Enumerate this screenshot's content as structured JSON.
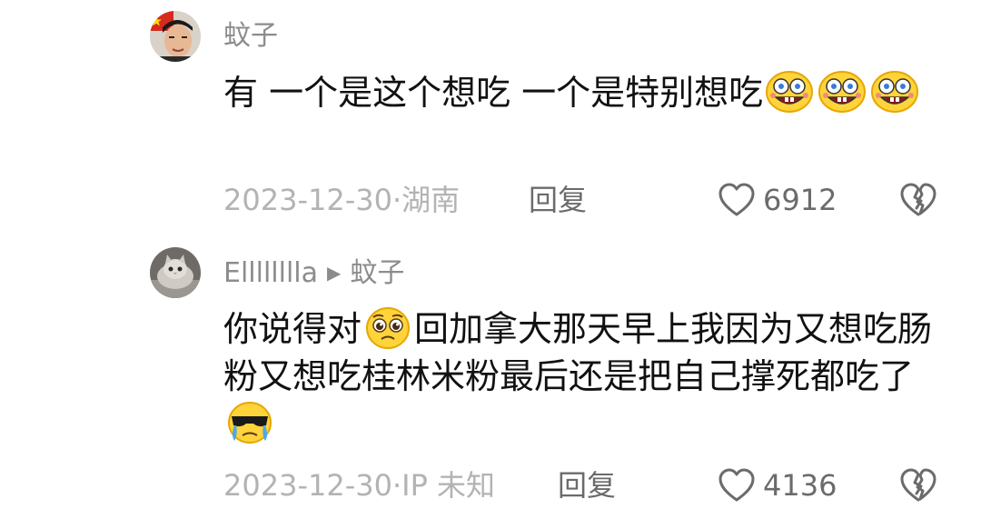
{
  "comments": [
    {
      "username": "蚊子",
      "avatar": "avatar-man-with-flag",
      "text": {
        "part1": "有  一个是这个想吃 一个是特别想吃"
      },
      "emojis": [
        "spongebob-laugh-emoji",
        "spongebob-laugh-emoji",
        "spongebob-laugh-emoji"
      ],
      "meta": "2023-12-30·湖南",
      "reply_label": "回复",
      "likes": "6912"
    },
    {
      "username": "Elllllllla",
      "reply_to": "蚊子",
      "avatar": "avatar-cat",
      "text": {
        "part1": "你说得对",
        "part2": "回加拿大那天早上我因为又想吃肠粉又想吃桂林米粉最后还是把自己撑死都吃了"
      },
      "emojis": [
        "pleading-emoji",
        "sunglasses-crying-emoji"
      ],
      "meta": "2023-12-30·IP 未知",
      "reply_label": "回复",
      "likes": "4136"
    }
  ],
  "colors": {
    "text_main": "#111111",
    "text_muted": "#8c8c8c",
    "meta": "#b3b3b3",
    "action": "#6b6b6b",
    "emoji_yellow": "#ffd43b"
  }
}
